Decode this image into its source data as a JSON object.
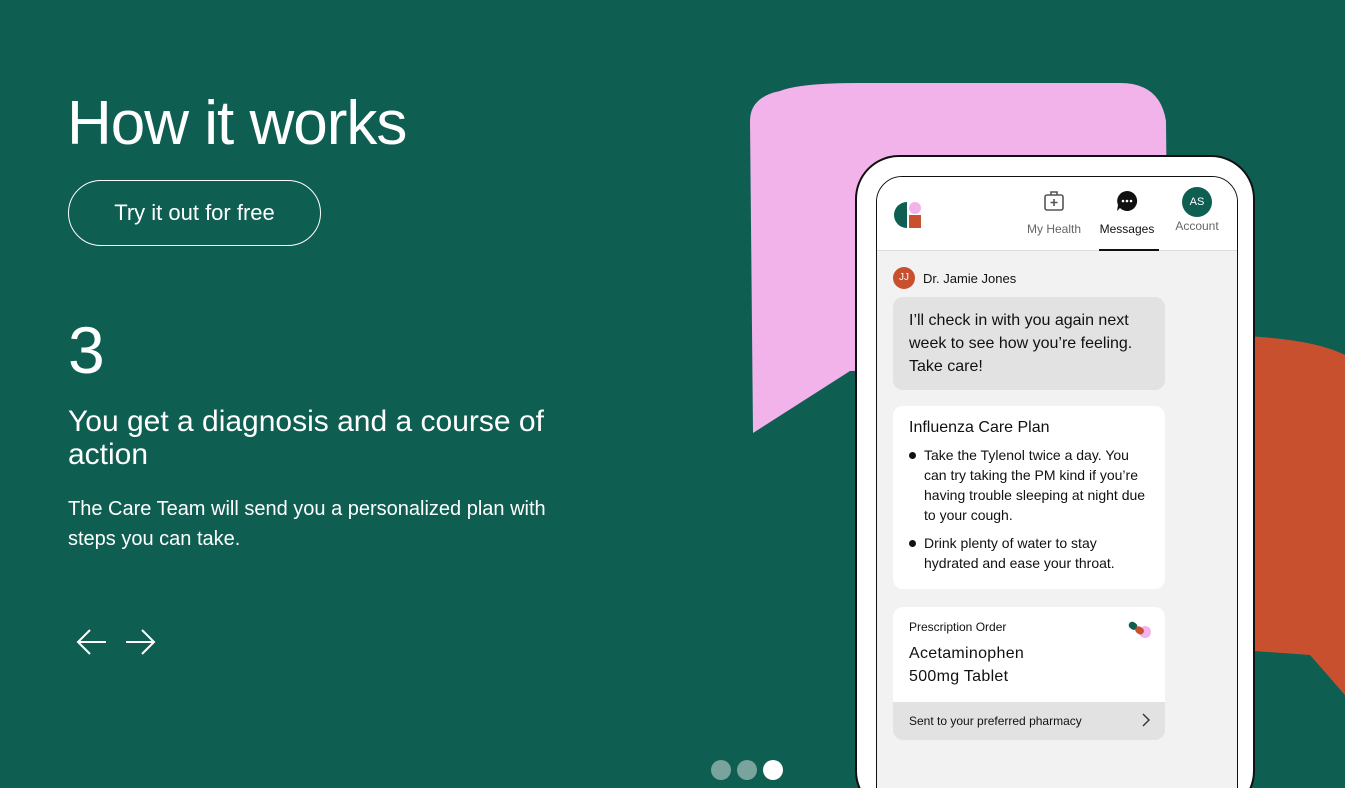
{
  "hero": {
    "heading": "How it works",
    "cta_label": "Try it out for free"
  },
  "step": {
    "number": "3",
    "title": "You get a diagnosis and a course of action",
    "description": "The Care Team will send you a personalized plan with steps you can take."
  },
  "carousel": {
    "prev_icon": "arrow-left-icon",
    "next_icon": "arrow-right-icon",
    "total_steps": 3,
    "current_step": 3
  },
  "phone": {
    "nav": {
      "my_health": "My Health",
      "messages": "Messages",
      "account": "Account",
      "account_initials": "AS"
    },
    "message": {
      "sender_initials": "JJ",
      "sender_name": "Dr. Jamie Jones",
      "text": "I’ll check in with you again next week to see how you’re feeling. Take care!"
    },
    "care_plan": {
      "title": "Influenza Care Plan",
      "items": [
        "Take the Tylenol twice a day. You can try taking the PM kind if you’re having trouble sleeping at night due to your cough.",
        "Drink plenty of water to stay hydrated and ease your throat."
      ]
    },
    "prescription": {
      "label": "Prescription Order",
      "name_line1": "Acetaminophen",
      "name_line2": "500mg Tablet",
      "footer": "Sent to your preferred pharmacy"
    }
  },
  "colors": {
    "background": "#0e5e52",
    "pink": "#f2b3ea",
    "orange": "#c8502f"
  }
}
